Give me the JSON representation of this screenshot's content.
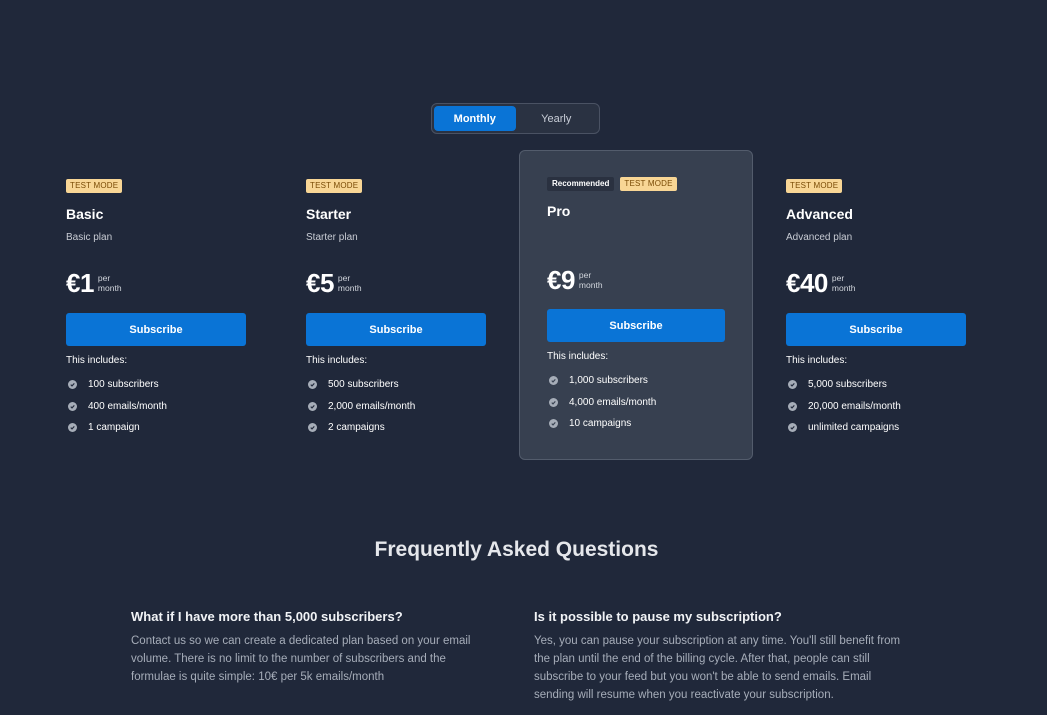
{
  "billing_toggle": {
    "options": [
      {
        "label": "Monthly",
        "active": true
      },
      {
        "label": "Yearly",
        "active": false
      }
    ]
  },
  "plans": [
    {
      "badge": "TEST MODE",
      "recommended": "",
      "name": "Basic",
      "description": "Basic plan",
      "price": "€1",
      "per_line1": "per",
      "per_line2": "month",
      "subscribe_label": "Subscribe",
      "includes_label": "This includes:",
      "features": [
        "100 subscribers",
        "400 emails/month",
        "1 campaign"
      ]
    },
    {
      "badge": "TEST MODE",
      "recommended": "",
      "name": "Starter",
      "description": "Starter plan",
      "price": "€5",
      "per_line1": "per",
      "per_line2": "month",
      "subscribe_label": "Subscribe",
      "includes_label": "This includes:",
      "features": [
        "500 subscribers",
        "2,000 emails/month",
        "2 campaigns"
      ]
    },
    {
      "badge": "TEST MODE",
      "recommended": "Recommended",
      "name": "Pro",
      "description": "",
      "price": "€9",
      "per_line1": "per",
      "per_line2": "month",
      "subscribe_label": "Subscribe",
      "includes_label": "This includes:",
      "features": [
        "1,000 subscribers",
        "4,000 emails/month",
        "10 campaigns"
      ]
    },
    {
      "badge": "TEST MODE",
      "recommended": "",
      "name": "Advanced",
      "description": "Advanced plan",
      "price": "€40",
      "per_line1": "per",
      "per_line2": "month",
      "subscribe_label": "Subscribe",
      "includes_label": "This includes:",
      "features": [
        "5,000 subscribers",
        "20,000 emails/month",
        "unlimited campaigns"
      ]
    }
  ],
  "faq": {
    "title": "Frequently Asked Questions",
    "items": [
      {
        "question": "What if I have more than 5,000 subscribers?",
        "answer": "Contact us so we can create a dedicated plan based on your email volume. There is no limit to the number of subscribers and the formulae is quite simple: 10€ per 5k emails/month"
      },
      {
        "question": "Is it possible to pause my subscription?",
        "answer": "Yes, you can pause your subscription at any time. You'll still benefit from the plan until the end of the billing cycle. After that, people can still subscribe to your feed but you won't be able to send emails. Email sending will resume when you reactivate your subscription."
      }
    ]
  },
  "colors": {
    "background": "#20283a",
    "accent": "#0a74d6",
    "featured_card": "#374050",
    "test_badge": "#f8d695"
  },
  "icons": {
    "feature_check": "check-circle-icon"
  }
}
